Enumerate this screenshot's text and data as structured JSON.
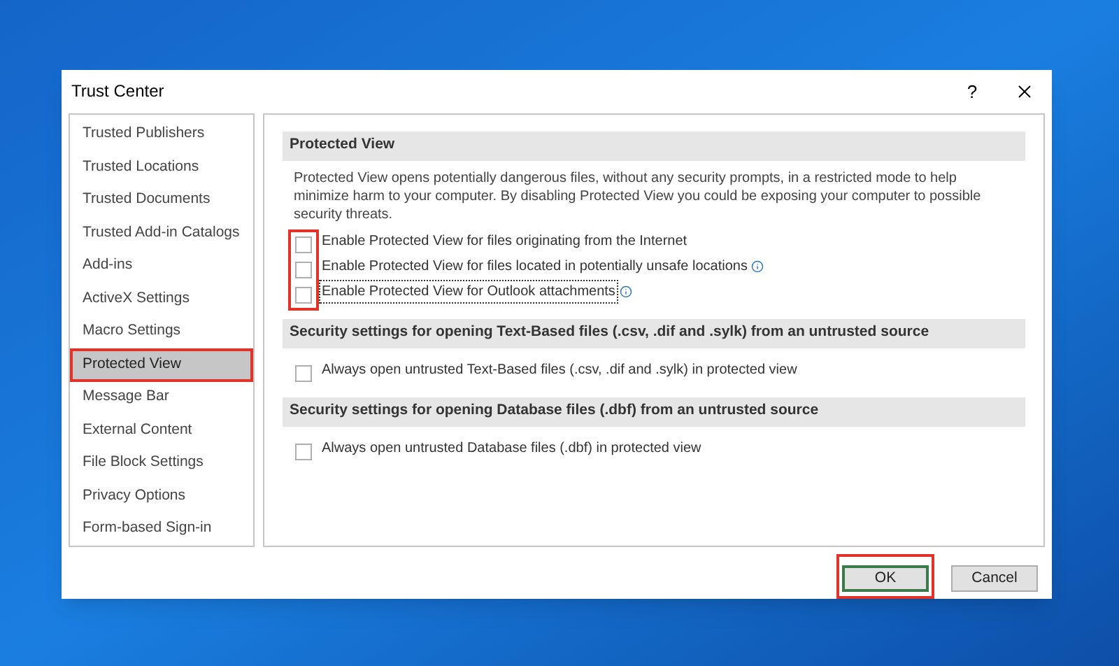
{
  "window": {
    "title": "Trust Center",
    "help": "?"
  },
  "sidebar": {
    "items": [
      {
        "label": "Trusted Publishers",
        "selected": false,
        "highlighted": false
      },
      {
        "label": "Trusted Locations",
        "selected": false,
        "highlighted": false
      },
      {
        "label": "Trusted Documents",
        "selected": false,
        "highlighted": false
      },
      {
        "label": "Trusted Add-in Catalogs",
        "selected": false,
        "highlighted": false
      },
      {
        "label": "Add-ins",
        "selected": false,
        "highlighted": false
      },
      {
        "label": "ActiveX Settings",
        "selected": false,
        "highlighted": false
      },
      {
        "label": "Macro Settings",
        "selected": false,
        "highlighted": false
      },
      {
        "label": "Protected View",
        "selected": true,
        "highlighted": true
      },
      {
        "label": "Message Bar",
        "selected": false,
        "highlighted": false
      },
      {
        "label": "External Content",
        "selected": false,
        "highlighted": false
      },
      {
        "label": "File Block Settings",
        "selected": false,
        "highlighted": false
      },
      {
        "label": "Privacy Options",
        "selected": false,
        "highlighted": false
      },
      {
        "label": "Form-based Sign-in",
        "selected": false,
        "highlighted": false
      }
    ]
  },
  "sections": [
    {
      "heading": "Protected View",
      "description": "Protected View opens potentially dangerous files, without any security prompts, in a restricted mode to help minimize harm to your computer. By disabling Protected View you could be exposing your computer to possible security threats.",
      "checkboxes_highlighted": true,
      "options": [
        {
          "label": "Enable Protected View for files originating from the Internet",
          "checked": false,
          "info": false,
          "focused": false
        },
        {
          "label": "Enable Protected View for files located in potentially unsafe locations",
          "checked": false,
          "info": true,
          "focused": false
        },
        {
          "label": "Enable Protected View for Outlook attachments",
          "checked": false,
          "info": true,
          "focused": true
        }
      ]
    },
    {
      "heading": "Security settings for opening Text-Based files (.csv, .dif and .sylk) from an untrusted source",
      "checkboxes_highlighted": false,
      "options": [
        {
          "label": "Always open untrusted Text-Based files (.csv, .dif and .sylk) in protected view",
          "checked": false,
          "info": false,
          "focused": false
        }
      ]
    },
    {
      "heading": "Security settings for opening Database files (.dbf) from an untrusted source",
      "checkboxes_highlighted": false,
      "options": [
        {
          "label": "Always open untrusted Database files (.dbf) in protected view",
          "checked": false,
          "info": false,
          "focused": false
        }
      ]
    }
  ],
  "buttons": [
    {
      "label": "OK",
      "default": true,
      "highlighted": true
    },
    {
      "label": "Cancel",
      "default": false,
      "highlighted": false
    }
  ]
}
